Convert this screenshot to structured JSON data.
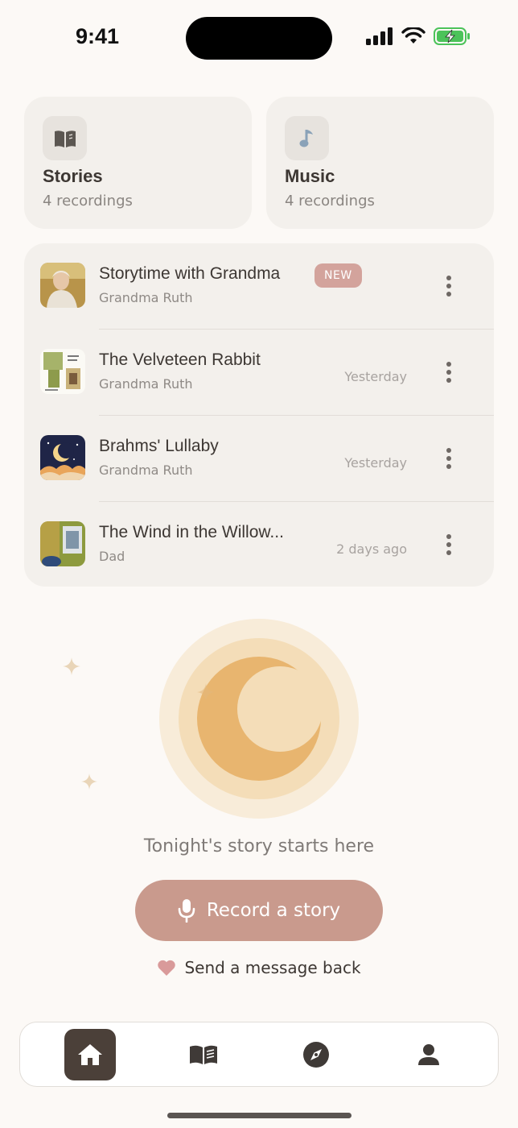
{
  "status_bar": {
    "time": "9:41"
  },
  "categories": [
    {
      "title": "Stories",
      "count": "4 recordings",
      "icon": "book-icon"
    },
    {
      "title": "Music",
      "count": "4 recordings",
      "icon": "music-note-icon"
    }
  ],
  "recordings": [
    {
      "title": "Storytime with Grandma",
      "author": "Grandma Ruth",
      "badge": "NEW",
      "when": ""
    },
    {
      "title": "The Velveteen Rabbit",
      "author": "Grandma Ruth",
      "badge": "",
      "when": "Yesterday"
    },
    {
      "title": "Brahms' Lullaby",
      "author": "Grandma Ruth",
      "badge": "",
      "when": "Yesterday"
    },
    {
      "title": "The Wind in the Willow...",
      "author": "Dad",
      "badge": "",
      "when": "2 days ago"
    }
  ],
  "hero": {
    "tagline": "Tonight's story starts here",
    "record_label": "Record a story",
    "send_label": "Send a message back"
  },
  "tabs": [
    {
      "name": "home",
      "icon": "home-icon",
      "active": true
    },
    {
      "name": "library",
      "icon": "open-book-icon",
      "active": false
    },
    {
      "name": "explore",
      "icon": "compass-icon",
      "active": false
    },
    {
      "name": "profile",
      "icon": "person-icon",
      "active": false
    }
  ],
  "colors": {
    "background": "#fcf9f6",
    "card": "#f3f0ec",
    "accent": "#c99a8d",
    "badge": "#d3a39c",
    "moon": "#e8b56f",
    "tab_active": "#4b4039"
  }
}
